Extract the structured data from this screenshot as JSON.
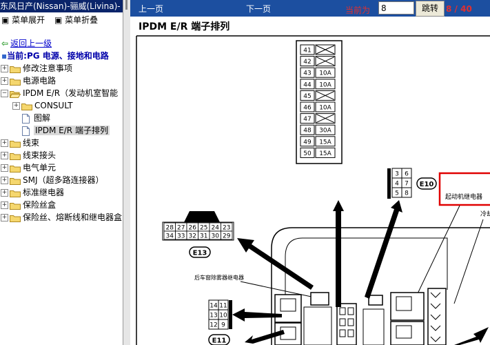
{
  "window_title": "东风日产(Nissan)-骊威(Livina)-",
  "menu": {
    "expand": "菜单展开",
    "collapse": "菜单折叠"
  },
  "back_link": "返回上一级",
  "current": "当前:PG 电源、接地和电路",
  "tree": [
    {
      "label": "修改注意事项",
      "type": "folder",
      "pm": "+",
      "level": 0
    },
    {
      "label": "电源电路",
      "type": "folder",
      "pm": "+",
      "level": 0
    },
    {
      "label": "IPDM E/R（发动机室智能",
      "type": "folder-open",
      "pm": "-",
      "level": 0
    },
    {
      "label": "CONSULT",
      "type": "folder",
      "pm": "+",
      "level": 1
    },
    {
      "label": "图解",
      "type": "doc",
      "pm": "",
      "level": 1
    },
    {
      "label": "IPDM E/R 端子排列",
      "type": "doc",
      "pm": "",
      "level": 1,
      "selected": true
    },
    {
      "label": "线束",
      "type": "folder",
      "pm": "+",
      "level": 0
    },
    {
      "label": "线束接头",
      "type": "folder",
      "pm": "+",
      "level": 0
    },
    {
      "label": "电气单元",
      "type": "folder",
      "pm": "+",
      "level": 0
    },
    {
      "label": "SMJ（超多路连接器）",
      "type": "folder",
      "pm": "+",
      "level": 0
    },
    {
      "label": "标准继电器",
      "type": "folder",
      "pm": "+",
      "level": 0
    },
    {
      "label": "保险丝盒",
      "type": "folder",
      "pm": "+",
      "level": 0
    },
    {
      "label": "保险丝、熔断线和继电器盒",
      "type": "folder",
      "pm": "+",
      "level": 0
    }
  ],
  "nav": {
    "prev": "上一页",
    "next": "下一页",
    "current_label": "当前为",
    "page_value": "8",
    "go": "跳转",
    "count": "8 / 40"
  },
  "doc_title": "IPDM E/R 端子排列",
  "fuses": [
    {
      "num": "41",
      "amp": ""
    },
    {
      "num": "42",
      "amp": ""
    },
    {
      "num": "43",
      "amp": "10A"
    },
    {
      "num": "44",
      "amp": "10A"
    },
    {
      "num": "45",
      "amp": ""
    },
    {
      "num": "46",
      "amp": "10A"
    },
    {
      "num": "47",
      "amp": ""
    },
    {
      "num": "48",
      "amp": "30A"
    },
    {
      "num": "49",
      "amp": "15A"
    },
    {
      "num": "50",
      "amp": "15A"
    }
  ],
  "connector_e10": {
    "name": "E10",
    "pins": [
      "3",
      "6",
      "4",
      "7",
      "5",
      "8"
    ]
  },
  "connector_e13": {
    "name": "E13",
    "row1": [
      "28",
      "27",
      "26",
      "25",
      "24",
      "23"
    ],
    "row2": [
      "34",
      "33",
      "32",
      "31",
      "30",
      "29"
    ]
  },
  "connector_e11": {
    "name": "E11",
    "pins": [
      "14",
      "11",
      "13",
      "10",
      "12",
      "9"
    ]
  },
  "labels": {
    "starter_relay": "起动机继电器",
    "rear_defog_relay": "后车窗除雾器继电器",
    "cooling": "冷却"
  },
  "colors": {
    "nav_bg": "#1c4fa0",
    "highlight": "#e00000",
    "title_bg": "#0a246a"
  }
}
